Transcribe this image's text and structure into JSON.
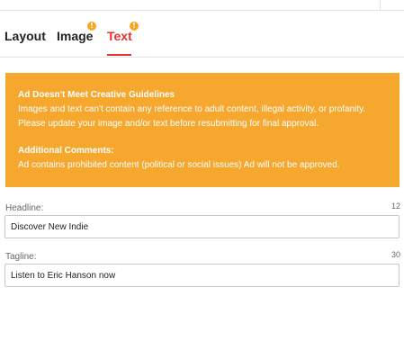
{
  "tabs": [
    {
      "label": "Layout",
      "warning": false,
      "active": false
    },
    {
      "label": "Image",
      "warning": true,
      "active": false
    },
    {
      "label": "Text",
      "warning": true,
      "active": true
    }
  ],
  "warning_glyph": "!",
  "alert": {
    "title": "Ad Doesn't Meet Creative Guidelines",
    "line1": "Images and text can't contain any reference to adult content, illegal activity, or profanity.",
    "line2": "Please update your image and/or text before resubmitting for final approval.",
    "comments_title": "Additional Comments:",
    "comments_text": "Ad contains prohibited content (political or social issues) Ad will not be approved.",
    "color": "#f5a72e"
  },
  "fields": {
    "headline": {
      "label": "Headline:",
      "count": "12",
      "value": "Discover New Indie"
    },
    "tagline": {
      "label": "Tagline:",
      "count": "30",
      "value": "Listen to Eric Hanson now"
    }
  },
  "colors": {
    "active_tab": "#e4312b",
    "warning_badge": "#f5a623"
  }
}
